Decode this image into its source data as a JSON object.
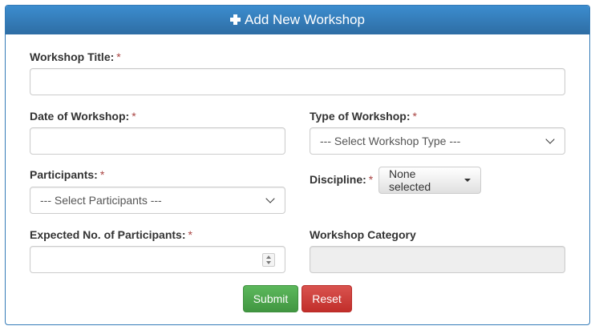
{
  "panel": {
    "title": "Add New Workshop",
    "icon": "plus-icon"
  },
  "form": {
    "title_label": "Workshop Title:",
    "title_value": "",
    "date_label": "Date of Workshop:",
    "date_value": "",
    "type_label": "Type of Workshop:",
    "type_selected": "--- Select Workshop Type ---",
    "participants_label": "Participants:",
    "participants_selected": "--- Select Participants ---",
    "discipline_label": "Discipline:",
    "discipline_selected": "None selected",
    "expected_label": "Expected No. of Participants:",
    "expected_value": "",
    "category_label": "Workshop Category",
    "category_value": "",
    "required_marker": "*"
  },
  "buttons": {
    "submit": "Submit",
    "reset": "Reset"
  },
  "colors": {
    "header": "#337ab7",
    "required": "#a94442",
    "submit": "#5cb85c",
    "reset": "#d9534f"
  }
}
